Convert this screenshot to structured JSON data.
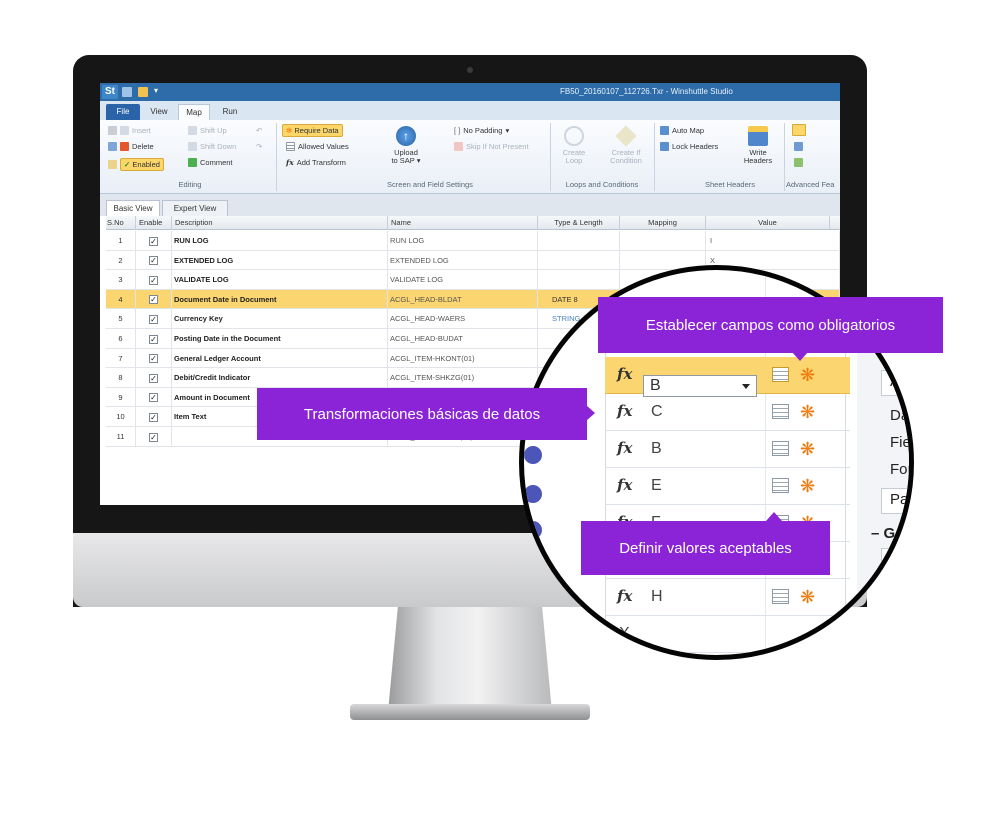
{
  "app": {
    "logo": "St",
    "window_title": "FB50_20160107_112726.Txr - Winshuttle Studio"
  },
  "ribbon_tabs": [
    "File",
    "View",
    "Map",
    "Run"
  ],
  "ribbon": {
    "editing": {
      "insert": "Insert",
      "delete": "Delete",
      "enabled": "Enabled",
      "shift_up": "Shift Up",
      "shift_down": "Shift Down",
      "comment": "Comment",
      "group": "Editing"
    },
    "screen_field": {
      "require_data": "Require Data",
      "allowed_values": "Allowed Values",
      "add_transform": "Add Transform",
      "upload_line1": "Upload",
      "upload_line2": "to SAP ▾",
      "no_padding": "No Padding",
      "skip_if_not_present": "Skip If Not Present",
      "group": "Screen and Field Settings"
    },
    "loops": {
      "create_loop_1": "Create",
      "create_loop_2": "Loop",
      "create_cond_1": "Create If",
      "create_cond_2": "Condition",
      "group": "Loops and Conditions"
    },
    "sheet_headers": {
      "auto_map": "Auto Map",
      "lock_headers": "Lock Headers",
      "write_1": "Write",
      "write_2": "Headers",
      "group": "Sheet Headers"
    },
    "advanced": {
      "group": "Advanced Fea"
    }
  },
  "view_tabs": [
    "Basic View",
    "Expert View"
  ],
  "grid": {
    "headers": [
      "S.No",
      "Enable",
      "Description",
      "Name",
      "Type & Length",
      "Mapping",
      "Value"
    ],
    "rows": [
      {
        "no": "1",
        "desc": "RUN LOG",
        "name": "RUN LOG",
        "type": "",
        "value": "I"
      },
      {
        "no": "2",
        "desc": "EXTENDED LOG",
        "name": "EXTENDED LOG",
        "type": "",
        "value": "X"
      },
      {
        "no": "3",
        "desc": "VALIDATE LOG",
        "name": "VALIDATE LOG",
        "type": "",
        "value": ""
      },
      {
        "no": "4",
        "desc": "Document Date in Document",
        "name": "ACGL_HEAD-BLDAT",
        "type": "DATE  8",
        "value": ""
      },
      {
        "no": "5",
        "desc": "Currency Key",
        "name": "ACGL_HEAD-WAERS",
        "type": "STRING",
        "value": ""
      },
      {
        "no": "6",
        "desc": "Posting Date in the Document",
        "name": "ACGL_HEAD-BUDAT",
        "type": "",
        "value": ""
      },
      {
        "no": "7",
        "desc": "General Ledger Account",
        "name": "ACGL_ITEM-HKONT(01)",
        "type": "",
        "value": ""
      },
      {
        "no": "8",
        "desc": "Debit/Credit Indicator",
        "name": "ACGL_ITEM-SHKZG(01)",
        "type": "",
        "value": ""
      },
      {
        "no": "9",
        "desc": "Amount in Document",
        "name": "ACGL_ITEM-WRBTR(01)",
        "type": "",
        "value": ""
      },
      {
        "no": "10",
        "desc": "Item Text",
        "name": "ACGL_ITEM-SGTXT(01)",
        "type": "",
        "value": ""
      },
      {
        "no": "11",
        "desc": "",
        "name": "ACGL_ITEM-KOSTL(01)",
        "type": "",
        "value": ""
      }
    ]
  },
  "zoom": {
    "mappings": [
      "B",
      "C",
      "B",
      "E",
      "F",
      "G",
      "H",
      "X"
    ],
    "side_labels": [
      "A",
      "Dat",
      "Fiel",
      "Forr",
      "Pad",
      "– Ge",
      "A"
    ]
  },
  "callouts": {
    "required": "Establecer campos como obligatorios",
    "transform": "Transformaciones básicas de datos",
    "allowed": "Definir valores aceptables"
  },
  "colors": {
    "accent": "#8a24d6",
    "selected_row": "#fbd670",
    "title_bar": "#2d6ca8",
    "require_star": "#f07a10"
  }
}
